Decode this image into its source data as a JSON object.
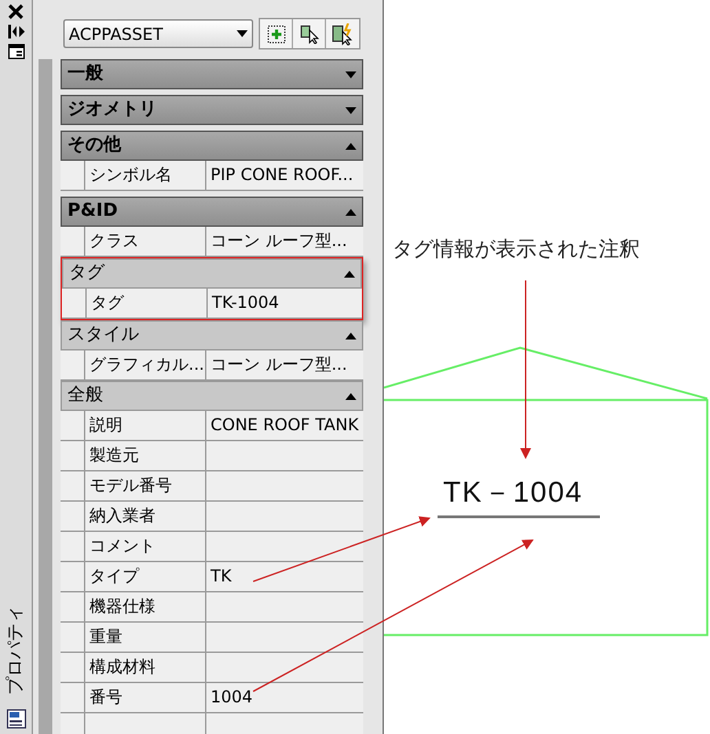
{
  "palette": {
    "title": "プロパティ"
  },
  "object_selector": {
    "value": "ACPPASSET"
  },
  "categories": [
    {
      "name": "一般",
      "kind": "dark",
      "expanded": false,
      "highlighted": false
    },
    {
      "name": "ジオメトリ",
      "kind": "dark",
      "expanded": false,
      "highlighted": false
    },
    {
      "name": "その他",
      "kind": "dark",
      "expanded": true,
      "highlighted": false,
      "properties": [
        {
          "label": "シンボル名",
          "value": "PIP CONE ROOF..."
        }
      ]
    },
    {
      "name": "P&ID",
      "kind": "dark",
      "expanded": true,
      "highlighted": false,
      "properties": [
        {
          "label": "クラス",
          "value": "コーン ルーフ型..."
        }
      ]
    },
    {
      "name": "タグ",
      "kind": "light",
      "expanded": true,
      "highlighted": true,
      "properties": [
        {
          "label": "タグ",
          "value": "TK-1004"
        }
      ]
    },
    {
      "name": "スタイル",
      "kind": "light",
      "expanded": true,
      "highlighted": false,
      "properties": [
        {
          "label": "グラフィカル...",
          "value": "コーン ルーフ型..."
        }
      ]
    },
    {
      "name": "全般",
      "kind": "light",
      "expanded": true,
      "highlighted": false,
      "properties": [
        {
          "label": "説明",
          "value": "CONE ROOF TANK"
        },
        {
          "label": "製造元"
        },
        {
          "label": "モデル番号"
        },
        {
          "label": "納入業者"
        },
        {
          "label": "コメント"
        },
        {
          "label": "タイプ",
          "value": "TK"
        },
        {
          "label": "機器仕様"
        },
        {
          "label": "重量"
        },
        {
          "label": "構成材料"
        },
        {
          "label": "番号",
          "value": "1004"
        }
      ]
    }
  ],
  "annotation": {
    "caption": "タグ情報が表示された注釈",
    "tag_text": "TK－1004"
  }
}
